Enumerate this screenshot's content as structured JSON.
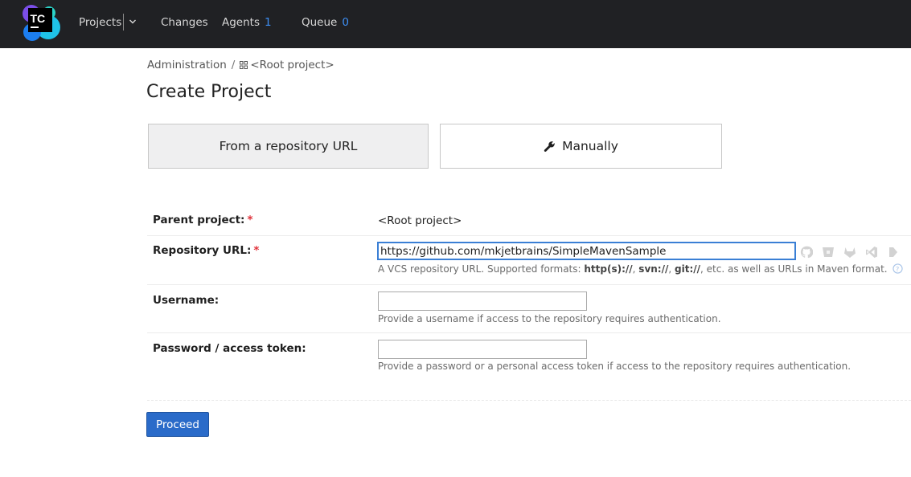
{
  "app": {
    "logo_text": "TC"
  },
  "nav": {
    "projects": "Projects",
    "changes": "Changes",
    "agents": "Agents",
    "agents_count": "1",
    "queue": "Queue",
    "queue_count": "0"
  },
  "breadcrumb": {
    "admin": "Administration",
    "separator": "/",
    "root": "<Root project>"
  },
  "page": {
    "title": "Create Project"
  },
  "modes": {
    "from_url": "From a repository URL",
    "manually": "Manually"
  },
  "form": {
    "parent_label": "Parent project:",
    "parent_value": "<Root project>",
    "repo_label": "Repository URL:",
    "repo_value": "https://github.com/mkjetbrains/SimpleMavenSample",
    "repo_hint_prefix": "A VCS repository URL. Supported formats: ",
    "repo_hint_f1": "http(s)://",
    "repo_hint_c1": ", ",
    "repo_hint_f2": "svn://",
    "repo_hint_c2": ", ",
    "repo_hint_f3": "git://",
    "repo_hint_suffix": ", etc. as well as URLs in Maven format.",
    "username_label": "Username:",
    "username_value": "",
    "username_hint": "Provide a username if access to the repository requires authentication.",
    "password_label": "Password / access token:",
    "password_value": "",
    "password_hint": "Provide a password or a personal access token if access to the repository requires authentication.",
    "required_mark": "*"
  },
  "actions": {
    "proceed": "Proceed"
  },
  "colors": {
    "topbar": "#202124",
    "accent": "#3d8ff5",
    "primary_button": "#2a6bc9",
    "required": "#e0313a"
  },
  "icons": [
    "teamcity-logo",
    "chevron-down-icon",
    "project-grid-icon",
    "wrench-icon",
    "help-icon",
    "github-icon",
    "bitbucket-icon",
    "gitlab-icon",
    "azure-devops-icon",
    "space-icon"
  ]
}
